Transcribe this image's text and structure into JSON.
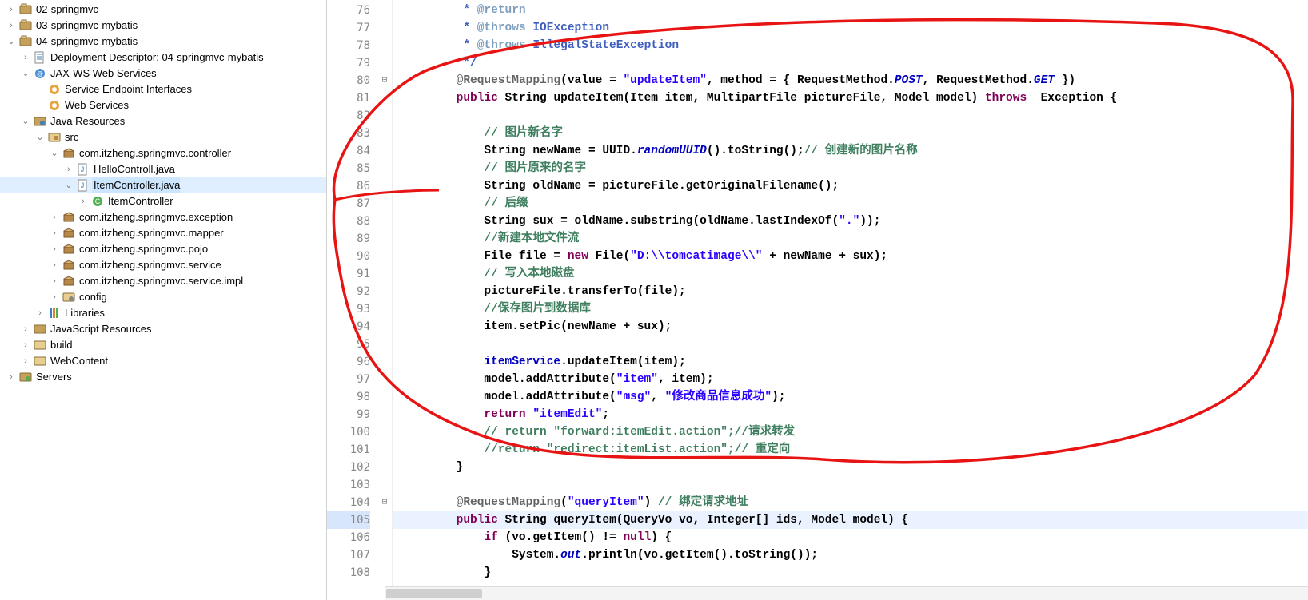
{
  "explorer": {
    "items": [
      {
        "d": 0,
        "tw": ">",
        "icon": "proj",
        "label": "02-springmvc"
      },
      {
        "d": 0,
        "tw": ">",
        "icon": "proj",
        "label": "03-springmvc-mybatis"
      },
      {
        "d": 0,
        "tw": "v",
        "icon": "proj",
        "label": "04-springmvc-mybatis"
      },
      {
        "d": 1,
        "tw": ">",
        "icon": "dd",
        "label": "Deployment Descriptor: 04-springmvc-mybatis"
      },
      {
        "d": 1,
        "tw": "v",
        "icon": "jax",
        "label": "JAX-WS Web Services"
      },
      {
        "d": 2,
        "tw": "",
        "icon": "ws",
        "label": "Service Endpoint Interfaces"
      },
      {
        "d": 2,
        "tw": "",
        "icon": "ws",
        "label": "Web Services"
      },
      {
        "d": 1,
        "tw": "v",
        "icon": "jres",
        "label": "Java Resources"
      },
      {
        "d": 2,
        "tw": "v",
        "icon": "src",
        "label": "src"
      },
      {
        "d": 3,
        "tw": "v",
        "icon": "pkg",
        "label": "com.itzheng.springmvc.controller"
      },
      {
        "d": 4,
        "tw": ">",
        "icon": "ju",
        "label": "HelloControll.java"
      },
      {
        "d": 4,
        "tw": "v",
        "icon": "ju",
        "label": "ItemController.java",
        "sel": true
      },
      {
        "d": 5,
        "tw": ">",
        "icon": "cls",
        "label": "ItemController"
      },
      {
        "d": 3,
        "tw": ">",
        "icon": "pkg",
        "label": "com.itzheng.springmvc.exception"
      },
      {
        "d": 3,
        "tw": ">",
        "icon": "pkg",
        "label": "com.itzheng.springmvc.mapper"
      },
      {
        "d": 3,
        "tw": ">",
        "icon": "pkg",
        "label": "com.itzheng.springmvc.pojo"
      },
      {
        "d": 3,
        "tw": ">",
        "icon": "pkg",
        "label": "com.itzheng.springmvc.service"
      },
      {
        "d": 3,
        "tw": ">",
        "icon": "pkg",
        "label": "com.itzheng.springmvc.service.impl"
      },
      {
        "d": 3,
        "tw": ">",
        "icon": "cfg",
        "label": "config"
      },
      {
        "d": 2,
        "tw": ">",
        "icon": "lib",
        "label": "Libraries"
      },
      {
        "d": 1,
        "tw": ">",
        "icon": "js",
        "label": "JavaScript Resources"
      },
      {
        "d": 1,
        "tw": ">",
        "icon": "fld",
        "label": "build"
      },
      {
        "d": 1,
        "tw": ">",
        "icon": "fld",
        "label": "WebContent"
      },
      {
        "d": 0,
        "tw": ">",
        "icon": "srv",
        "label": "Servers"
      }
    ]
  },
  "editor": {
    "first_line": 76,
    "highlight_line": 105,
    "fold_minus_lines": [
      80,
      104
    ],
    "lines": [
      [
        {
          "c": "doc",
          "t": "         * "
        },
        {
          "c": "doctag",
          "t": "@return"
        }
      ],
      [
        {
          "c": "doc",
          "t": "         * "
        },
        {
          "c": "doctag",
          "t": "@throws"
        },
        {
          "c": "doc",
          "t": " IOException"
        }
      ],
      [
        {
          "c": "doc",
          "t": "         * "
        },
        {
          "c": "doctag",
          "t": "@throws"
        },
        {
          "c": "doc",
          "t": " IllegalStateException"
        }
      ],
      [
        {
          "c": "doc",
          "t": "         */"
        }
      ],
      [
        {
          "c": "",
          "t": "        "
        },
        {
          "c": "ann",
          "t": "@RequestMapping"
        },
        {
          "c": "",
          "t": "(value = "
        },
        {
          "c": "str",
          "t": "\"updateItem\""
        },
        {
          "c": "",
          "t": ", method = { RequestMethod."
        },
        {
          "c": "sit",
          "t": "POST"
        },
        {
          "c": "",
          "t": ", RequestMethod."
        },
        {
          "c": "sit",
          "t": "GET"
        },
        {
          "c": "",
          "t": " })"
        }
      ],
      [
        {
          "c": "",
          "t": "        "
        },
        {
          "c": "kw",
          "t": "public"
        },
        {
          "c": "",
          "t": " String updateItem(Item item, MultipartFile pictureFile, Model model) "
        },
        {
          "c": "kw",
          "t": "throws"
        },
        {
          "c": "",
          "t": "  Exception {"
        }
      ],
      [
        {
          "c": "",
          "t": ""
        }
      ],
      [
        {
          "c": "",
          "t": "            "
        },
        {
          "c": "cmt",
          "t": "// 图片新名字"
        }
      ],
      [
        {
          "c": "",
          "t": "            String newName = UUID."
        },
        {
          "c": "it",
          "t": "randomUUID"
        },
        {
          "c": "",
          "t": "().toString();"
        },
        {
          "c": "cmt",
          "t": "// 创建新的图片名称"
        }
      ],
      [
        {
          "c": "",
          "t": "            "
        },
        {
          "c": "cmt",
          "t": "// 图片原来的名字"
        }
      ],
      [
        {
          "c": "",
          "t": "            String oldName = pictureFile.getOriginalFilename();"
        }
      ],
      [
        {
          "c": "",
          "t": "            "
        },
        {
          "c": "cmt",
          "t": "// 后缀"
        }
      ],
      [
        {
          "c": "",
          "t": "            String sux = oldName.substring(oldName.lastIndexOf("
        },
        {
          "c": "str",
          "t": "\".\""
        },
        {
          "c": "",
          "t": "));"
        }
      ],
      [
        {
          "c": "",
          "t": "            "
        },
        {
          "c": "cmt",
          "t": "//新建本地文件流"
        }
      ],
      [
        {
          "c": "",
          "t": "            File file = "
        },
        {
          "c": "kw",
          "t": "new"
        },
        {
          "c": "",
          "t": " File("
        },
        {
          "c": "str",
          "t": "\"D:\\\\tomcatimage\\\\\""
        },
        {
          "c": "",
          "t": " + newName + sux);"
        }
      ],
      [
        {
          "c": "",
          "t": "            "
        },
        {
          "c": "cmt",
          "t": "// 写入本地磁盘"
        }
      ],
      [
        {
          "c": "",
          "t": "            pictureFile.transferTo(file);"
        }
      ],
      [
        {
          "c": "",
          "t": "            "
        },
        {
          "c": "cmt",
          "t": "//保存图片到数据库"
        }
      ],
      [
        {
          "c": "",
          "t": "            item.setPic(newName + sux);"
        }
      ],
      [
        {
          "c": "",
          "t": ""
        }
      ],
      [
        {
          "c": "",
          "t": "            "
        },
        {
          "c": "fld",
          "t": "itemService"
        },
        {
          "c": "",
          "t": ".updateItem(item);"
        }
      ],
      [
        {
          "c": "",
          "t": "            model.addAttribute("
        },
        {
          "c": "str",
          "t": "\"item\""
        },
        {
          "c": "",
          "t": ", item);"
        }
      ],
      [
        {
          "c": "",
          "t": "            model.addAttribute("
        },
        {
          "c": "str",
          "t": "\"msg\""
        },
        {
          "c": "",
          "t": ", "
        },
        {
          "c": "str",
          "t": "\"修改商品信息成功\""
        },
        {
          "c": "",
          "t": ");"
        }
      ],
      [
        {
          "c": "",
          "t": "            "
        },
        {
          "c": "kw",
          "t": "return"
        },
        {
          "c": "",
          "t": " "
        },
        {
          "c": "str",
          "t": "\"itemEdit\""
        },
        {
          "c": "",
          "t": ";"
        }
      ],
      [
        {
          "c": "",
          "t": "            "
        },
        {
          "c": "cmt",
          "t": "// return \"forward:itemEdit.action\";//请求转发"
        }
      ],
      [
        {
          "c": "",
          "t": "            "
        },
        {
          "c": "cmt",
          "t": "//return \"redirect:itemList.action\";// 重定向"
        }
      ],
      [
        {
          "c": "",
          "t": "        }"
        }
      ],
      [
        {
          "c": "",
          "t": ""
        }
      ],
      [
        {
          "c": "",
          "t": "        "
        },
        {
          "c": "ann",
          "t": "@RequestMapping"
        },
        {
          "c": "",
          "t": "("
        },
        {
          "c": "str",
          "t": "\"queryItem\""
        },
        {
          "c": "",
          "t": ") "
        },
        {
          "c": "cmt",
          "t": "// 绑定请求地址"
        }
      ],
      [
        {
          "c": "",
          "t": "        "
        },
        {
          "c": "kw",
          "t": "public"
        },
        {
          "c": "",
          "t": " String queryItem(QueryVo vo, Integer[] ids, Model model) {"
        }
      ],
      [
        {
          "c": "",
          "t": "            "
        },
        {
          "c": "kw",
          "t": "if"
        },
        {
          "c": "",
          "t": " (vo.getItem() != "
        },
        {
          "c": "kw",
          "t": "null"
        },
        {
          "c": "",
          "t": ") {"
        }
      ],
      [
        {
          "c": "",
          "t": "                System."
        },
        {
          "c": "sit",
          "t": "out"
        },
        {
          "c": "",
          "t": ".println(vo.getItem().toString());"
        }
      ],
      [
        {
          "c": "",
          "t": "            }"
        }
      ]
    ]
  },
  "watermark": ""
}
